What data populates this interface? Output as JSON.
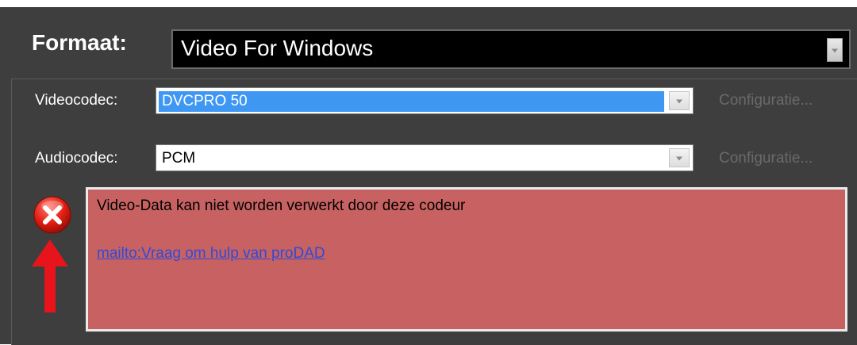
{
  "format": {
    "label": "Formaat:",
    "value": "Video For Windows"
  },
  "video": {
    "label": "Videocodec:",
    "value": "DVCPRO 50",
    "config_label": "Configuratie..."
  },
  "audio": {
    "label": "Audiocodec:",
    "value": "PCM",
    "config_label": "Configuratie..."
  },
  "error": {
    "message": "Video-Data kan niet worden verwerkt door deze codeur",
    "link": "mailto:Vraag om hulp van proDAD"
  },
  "colors": {
    "error_background": "#c86262",
    "selection": "#3f97f4",
    "annotation_arrow": "#e8141b"
  },
  "icons": {
    "error": "error-x-icon",
    "dropdown": "chevron-down-icon",
    "annotation": "red-arrow-up"
  }
}
